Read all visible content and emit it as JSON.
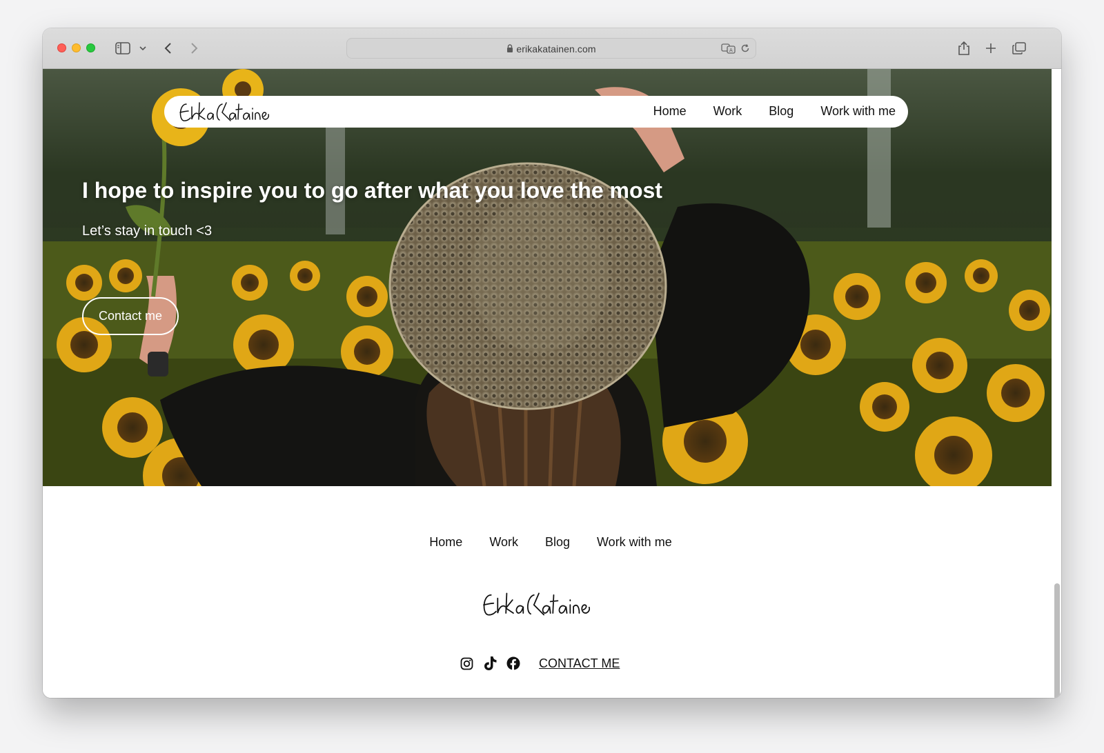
{
  "browser": {
    "url": "erikakatainen.com"
  },
  "site": {
    "logo_text": "Erika Katainen",
    "nav": [
      "Home",
      "Work",
      "Blog",
      "Work with me"
    ]
  },
  "hero": {
    "title": "I hope to inspire you to go after what you love the most",
    "subtitle": "Let’s stay in touch <3",
    "cta": "Contact me"
  },
  "footer": {
    "nav": [
      "Home",
      "Work",
      "Blog",
      "Work with me"
    ],
    "logo_text": "Erika Katainen",
    "social_icons": [
      "instagram-icon",
      "tiktok-icon",
      "facebook-icon"
    ],
    "contact_link": "CONTACT ME"
  },
  "colors": {
    "window_chrome": "#d6d6d6",
    "page_background": "#ffffff",
    "sunflower_yellow": "#e8b419"
  }
}
